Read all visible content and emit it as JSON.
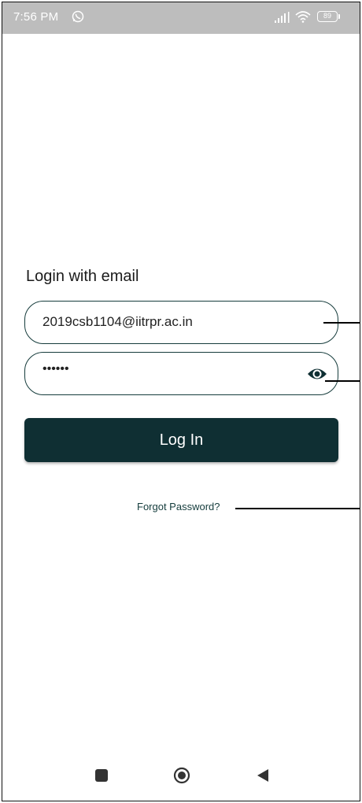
{
  "status_bar": {
    "time": "7:56 PM",
    "battery": "89"
  },
  "login": {
    "title": "Login with email",
    "email_value": "2019csb1104@iitrpr.ac.in",
    "password_masked": "••••••",
    "button_label": "Log In",
    "forgot_link": "Forgot Password?"
  },
  "icons": {
    "status": [
      "whatsapp-icon",
      "signal-icon",
      "wifi-icon",
      "battery-icon"
    ],
    "password_toggle": "eye-icon",
    "nav": [
      "recents-square-icon",
      "home-circle-icon",
      "back-triangle-icon"
    ]
  },
  "colors": {
    "primary": "#0f2f33",
    "status_bar": "#bdbdbd",
    "outline": "#163c3c"
  }
}
